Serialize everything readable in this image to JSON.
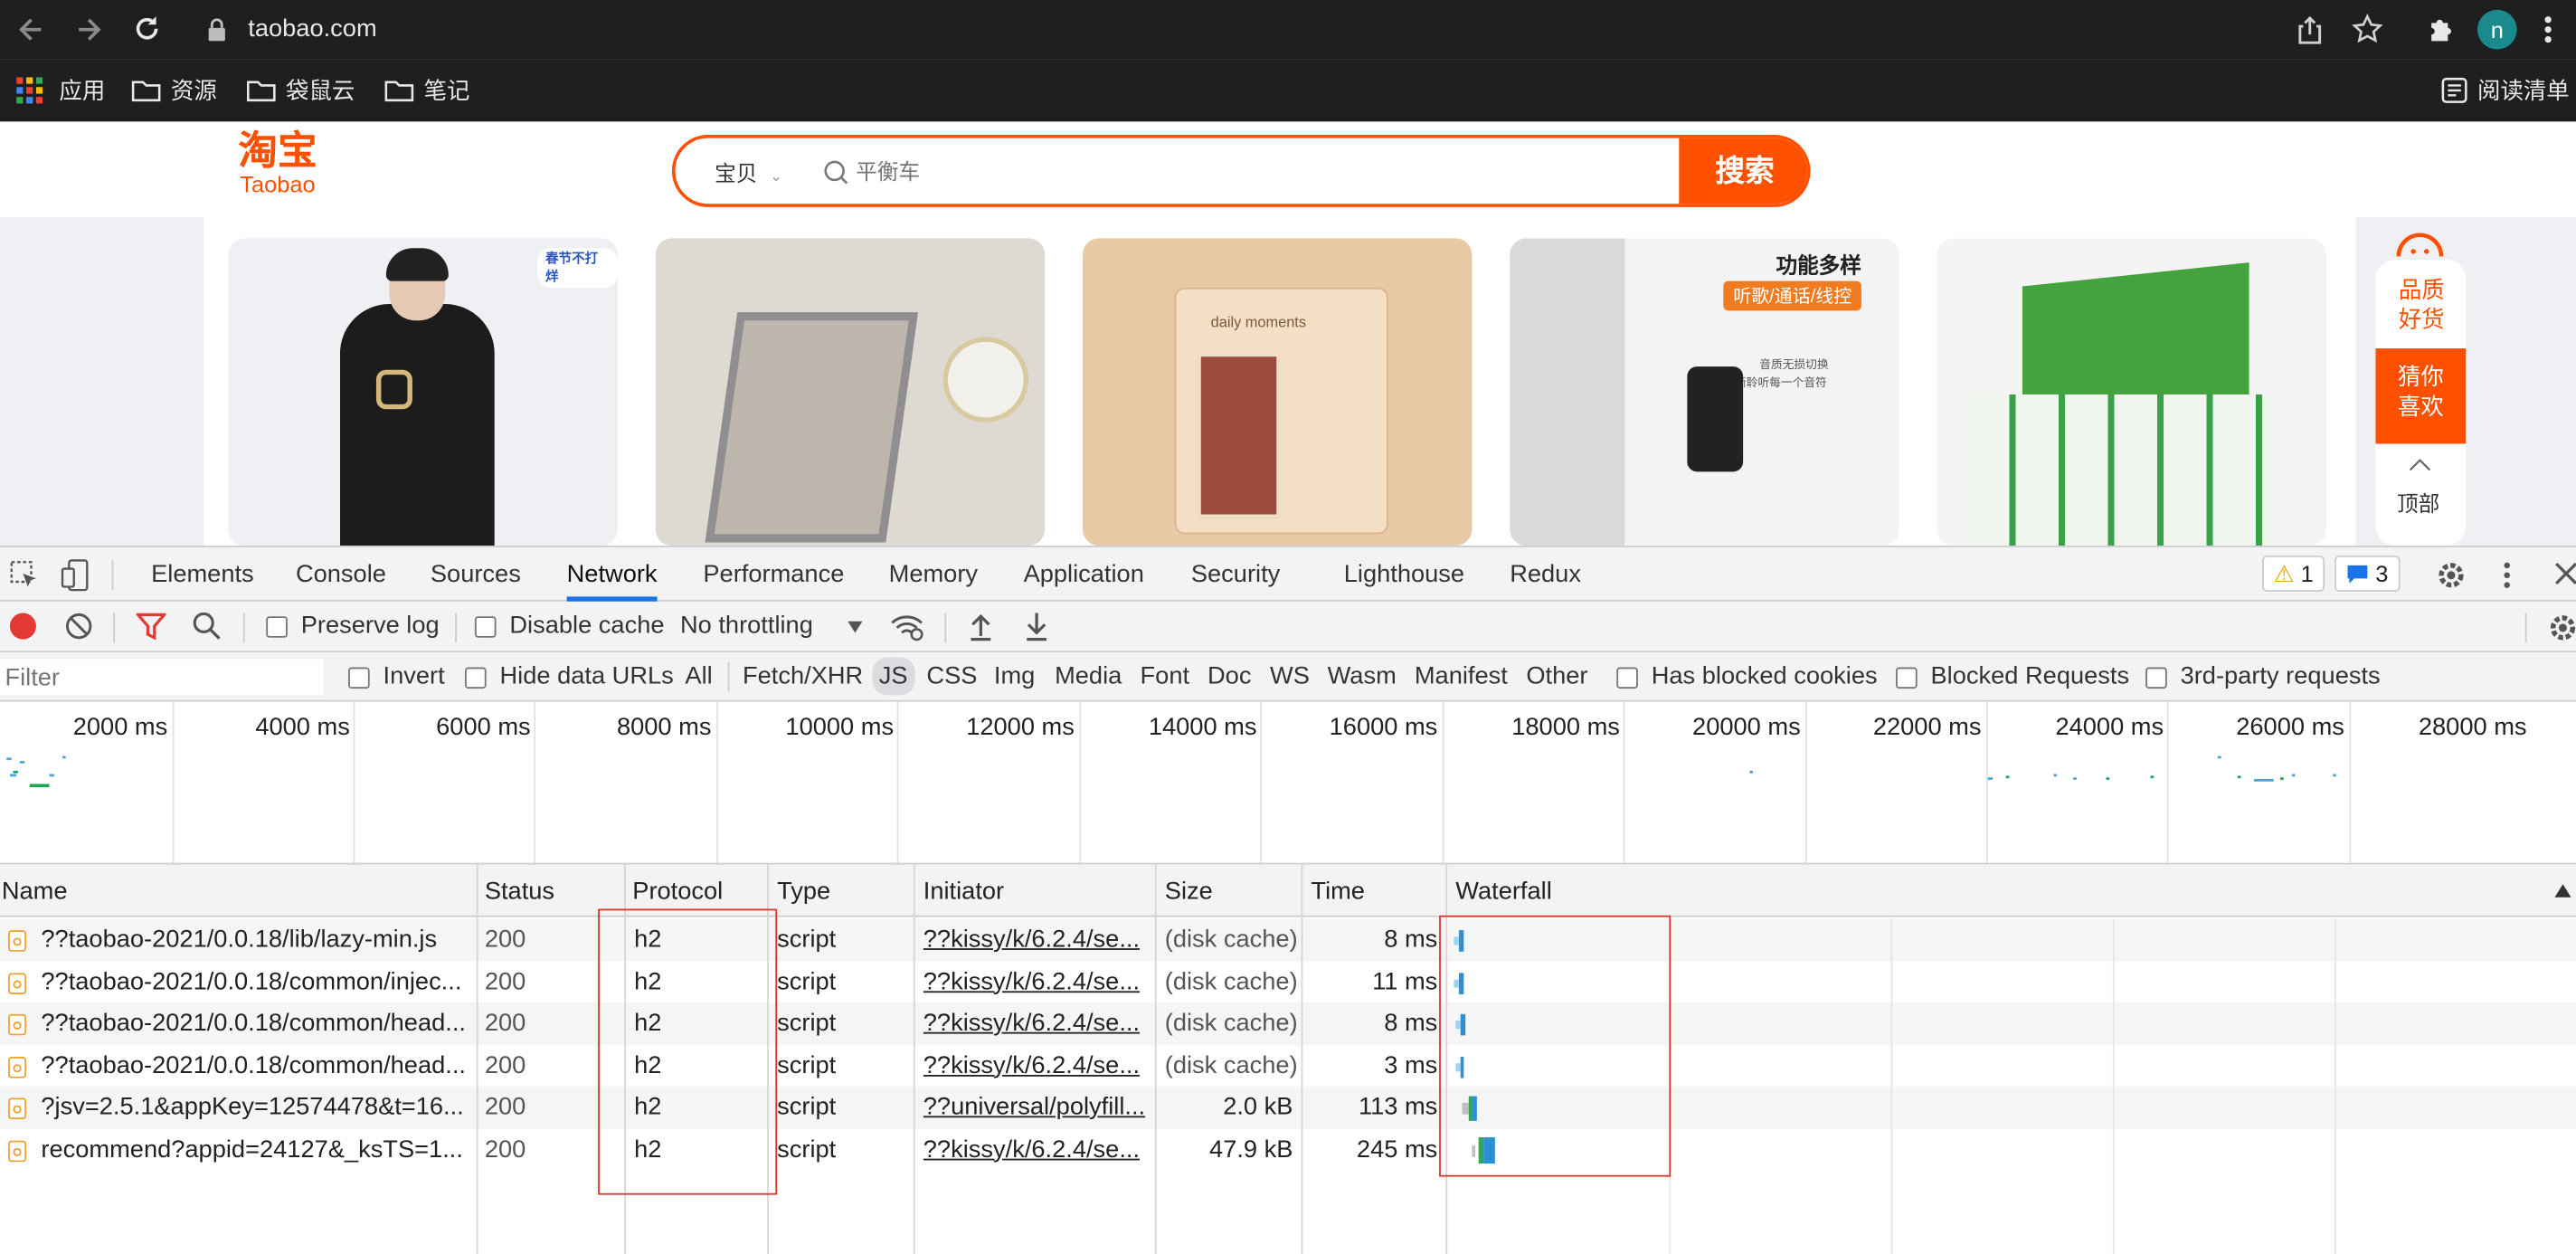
{
  "browser": {
    "url": "taobao.com",
    "avatar_letter": "n",
    "bookmarks": [
      "应用",
      "资源",
      "袋鼠云",
      "笔记"
    ],
    "reading_list": "阅读清单"
  },
  "taobao": {
    "logo_cn": "淘宝",
    "logo_en": "Taobao",
    "search_category": "宝贝",
    "search_placeholder": "平衡车",
    "search_button": "搜索",
    "banner_feature_title": "功能多样",
    "banner_feature_tag": "听歌/通话/线控",
    "banner_feature_line1": "音质无损切换",
    "banner_feature_line2": "清晰聆听每一个音符",
    "banner_sticker": "春节不打烊",
    "banner_daily": "daily moments",
    "side_quality": "品质好货",
    "side_guess": "猜你喜欢",
    "side_top": "顶部"
  },
  "devtools": {
    "tabs": [
      "Elements",
      "Console",
      "Sources",
      "Network",
      "Performance",
      "Memory",
      "Application",
      "Security",
      "Lighthouse",
      "Redux"
    ],
    "active_tab": "Network",
    "warnings": "1",
    "messages": "3",
    "preserve_log": "Preserve log",
    "disable_cache": "Disable cache",
    "throttling": "No throttling",
    "filter_placeholder": "Filter",
    "invert": "Invert",
    "hide_data_urls": "Hide data URLs",
    "type_filters": [
      "All",
      "Fetch/XHR",
      "JS",
      "CSS",
      "Img",
      "Media",
      "Font",
      "Doc",
      "WS",
      "Wasm",
      "Manifest",
      "Other"
    ],
    "active_type_filter": "JS",
    "has_blocked_cookies": "Has blocked cookies",
    "blocked_requests": "Blocked Requests",
    "third_party": "3rd-party requests",
    "timeline_ticks": [
      "2000 ms",
      "4000 ms",
      "6000 ms",
      "8000 ms",
      "10000 ms",
      "12000 ms",
      "14000 ms",
      "16000 ms",
      "18000 ms",
      "20000 ms",
      "22000 ms",
      "24000 ms",
      "26000 ms",
      "28000 ms"
    ],
    "columns": [
      "Name",
      "Status",
      "Protocol",
      "Type",
      "Initiator",
      "Size",
      "Time",
      "Waterfall"
    ],
    "requests": [
      {
        "name": "??taobao-2021/0.0.18/lib/lazy-min.js",
        "status": "200",
        "protocol": "h2",
        "type": "script",
        "initiator": "??kissy/k/6.2.4/se...",
        "size": "(disk cache)",
        "time": "8 ms"
      },
      {
        "name": "??taobao-2021/0.0.18/common/injec...",
        "status": "200",
        "protocol": "h2",
        "type": "script",
        "initiator": "??kissy/k/6.2.4/se...",
        "size": "(disk cache)",
        "time": "11 ms"
      },
      {
        "name": "??taobao-2021/0.0.18/common/head...",
        "status": "200",
        "protocol": "h2",
        "type": "script",
        "initiator": "??kissy/k/6.2.4/se...",
        "size": "(disk cache)",
        "time": "8 ms"
      },
      {
        "name": "??taobao-2021/0.0.18/common/head...",
        "status": "200",
        "protocol": "h2",
        "type": "script",
        "initiator": "??kissy/k/6.2.4/se...",
        "size": "(disk cache)",
        "time": "3 ms"
      },
      {
        "name": "?jsv=2.5.1&appKey=12574478&t=16...",
        "status": "200",
        "protocol": "h2",
        "type": "script",
        "initiator": "??universal/polyfill...",
        "size": "2.0 kB",
        "time": "113 ms"
      },
      {
        "name": "recommend?appid=24127&_ksTS=1...",
        "status": "200",
        "protocol": "h2",
        "type": "script",
        "initiator": "??kissy/k/6.2.4/se...",
        "size": "47.9 kB",
        "time": "245 ms"
      }
    ]
  }
}
